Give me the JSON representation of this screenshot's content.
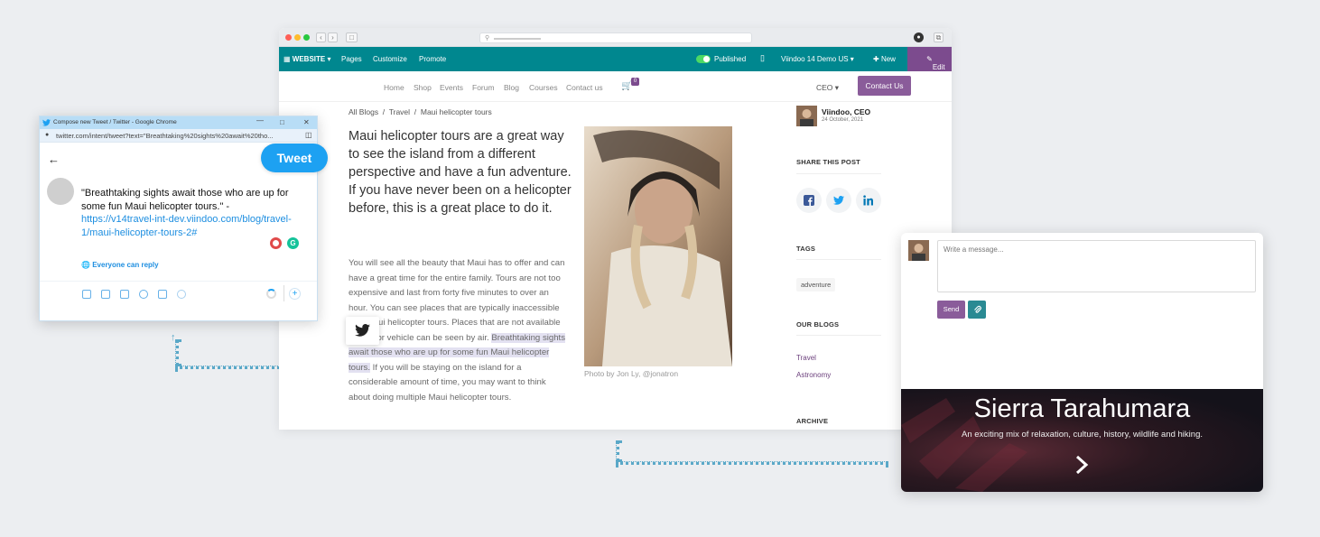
{
  "browser": {
    "odoo_bar": {
      "website": "WEBSITE",
      "pages": "Pages",
      "customize": "Customize",
      "promote": "Promote",
      "published": "Published",
      "company": "Viindoo 14 Demo US",
      "new": "New",
      "edit": "Edit"
    },
    "nav": {
      "links": [
        "Home",
        "Shop",
        "Events",
        "Forum",
        "Blog",
        "Courses",
        "Contact us"
      ],
      "cart_count": "0",
      "user": "CEO",
      "contact_btn": "Contact Us"
    },
    "breadcrumb": [
      "All Blogs",
      "Travel",
      "Maui helicopter tours"
    ],
    "lead": "Maui helicopter tours are a great way to see the island from a different perspective and have a fun adventure. If you have never been on a helicopter before, this is a great place to do it.",
    "body": {
      "part1": "You will see all the beauty that Maui has to offer and can have a great time for the entire family. Tours are not too expensive and last from forty five minutes to over an hour. You can see places that are typically inaccessible with Maui helicopter tours. Places that are not available by foot or vehicle can be seen by air.",
      "highlight": "Breathtaking sights await those who are up for some fun Maui helicopter tours.",
      "part2": "If you will be staying on the island for a considerable amount of time, you may want to think about doing multiple Maui helicopter tours."
    },
    "photo_caption": "Photo by Jon Ly, @jonatron",
    "sidebar": {
      "author": "Viindoo, CEO",
      "date": "24 October, 2021",
      "share_title": "SHARE THIS POST",
      "tags_title": "TAGS",
      "tag": "adventure",
      "blogs_title": "OUR BLOGS",
      "blogs": [
        "Travel",
        "Astronomy"
      ],
      "archive_title": "ARCHIVE"
    }
  },
  "tweet": {
    "window_title": "Compose new Tweet / Twitter - Google Chrome",
    "url": "twitter.com/intent/tweet?text=\"Breathtaking%20sights%20await%20tho...",
    "button": "Tweet",
    "text": "\"Breathtaking sights await those who are up for some fun Maui helicopter tours.\" -",
    "link": "https://v14travel-int-dev.viindoo.com/blog/travel-1/maui-helicopter-tours-2#",
    "reply": "Everyone can reply"
  },
  "card": {
    "placeholder": "Write a message...",
    "send": "Send",
    "hero_title": "Sierra Tarahumara",
    "hero_sub": "An exciting mix of relaxation, culture, history, wildlife and hiking."
  },
  "colors": {
    "odoo_teal": "#00878f",
    "odoo_purple": "#7c4b8e",
    "twitter_blue": "#1da1f2"
  }
}
